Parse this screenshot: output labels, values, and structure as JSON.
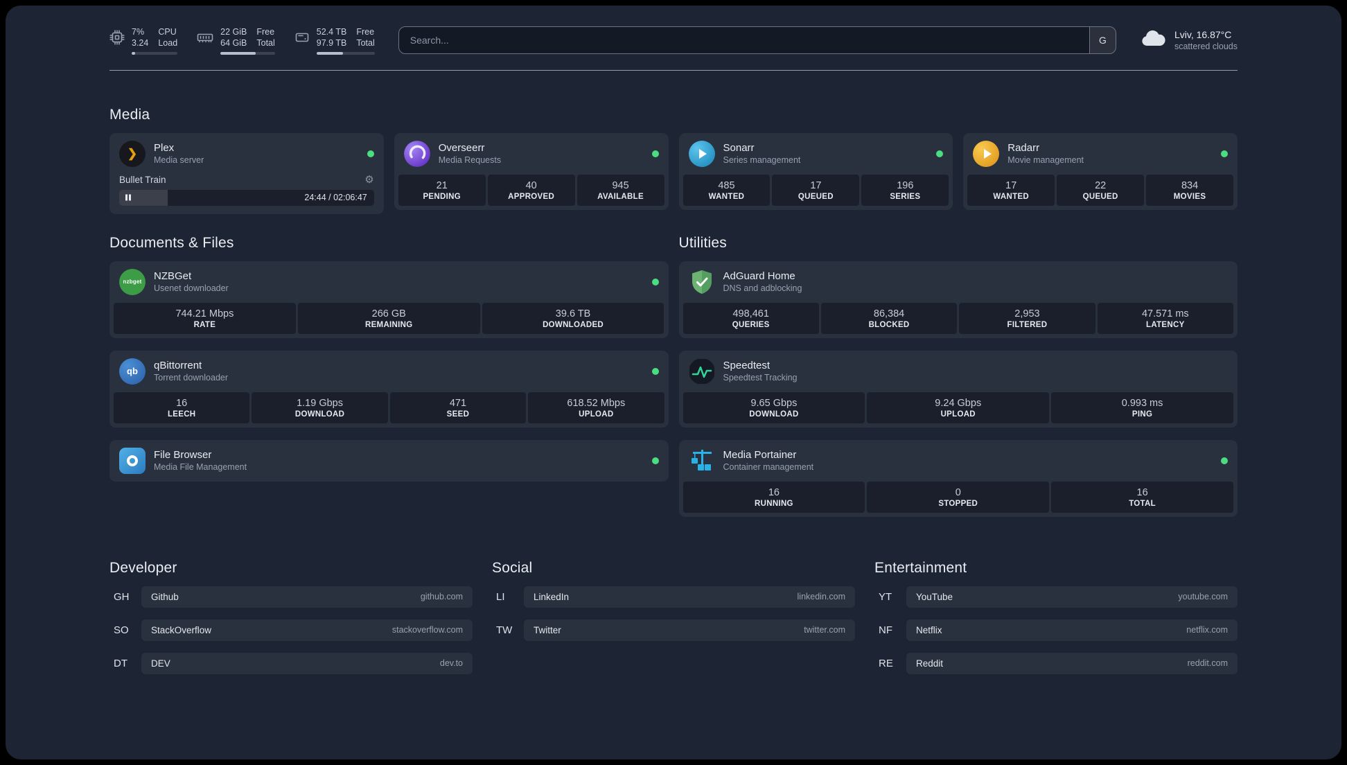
{
  "theme": {
    "background": "#1d2433",
    "status_online": "#4ade80",
    "plex_accent": "#e5a00d",
    "nzbget_green": "#3d9c46",
    "speedtest_green": "#34d399",
    "portainer_blue": "#29b2e8"
  },
  "topbar": {
    "resources": [
      {
        "name": "cpu",
        "values": [
          "7%",
          "3.24"
        ],
        "labels": [
          "CPU",
          "Load"
        ],
        "percent": 7
      },
      {
        "name": "memory",
        "values": [
          "22 GiB",
          "64 GiB"
        ],
        "labels": [
          "Free",
          "Total"
        ],
        "percent": 65
      },
      {
        "name": "disk",
        "values": [
          "52.4 TB",
          "97.9 TB"
        ],
        "labels": [
          "Free",
          "Total"
        ],
        "percent": 46
      }
    ],
    "search": {
      "placeholder": "Search...",
      "engine_label": "G"
    },
    "weather": {
      "location": "Lviv, 16.87°C",
      "condition": "scattered clouds"
    }
  },
  "sections": {
    "media": {
      "title": "Media",
      "services": [
        {
          "name": "Plex",
          "description": "Media server",
          "status": "online",
          "player": {
            "title": "Bullet Train",
            "time": "24:44 / 02:06:47",
            "progress_percent": 19
          }
        },
        {
          "name": "Overseerr",
          "description": "Media Requests",
          "status": "online",
          "stats": [
            {
              "value": "21",
              "label": "PENDING"
            },
            {
              "value": "40",
              "label": "APPROVED"
            },
            {
              "value": "945",
              "label": "AVAILABLE"
            }
          ]
        },
        {
          "name": "Sonarr",
          "description": "Series management",
          "status": "online",
          "stats": [
            {
              "value": "485",
              "label": "WANTED"
            },
            {
              "value": "17",
              "label": "QUEUED"
            },
            {
              "value": "196",
              "label": "SERIES"
            }
          ]
        },
        {
          "name": "Radarr",
          "description": "Movie management",
          "status": "online",
          "stats": [
            {
              "value": "17",
              "label": "WANTED"
            },
            {
              "value": "22",
              "label": "QUEUED"
            },
            {
              "value": "834",
              "label": "MOVIES"
            }
          ]
        }
      ]
    },
    "documents": {
      "title": "Documents & Files",
      "services": [
        {
          "name": "NZBGet",
          "description": "Usenet downloader",
          "status": "online",
          "stats": [
            {
              "value": "744.21 Mbps",
              "label": "RATE"
            },
            {
              "value": "266 GB",
              "label": "REMAINING"
            },
            {
              "value": "39.6 TB",
              "label": "DOWNLOADED"
            }
          ]
        },
        {
          "name": "qBittorrent",
          "description": "Torrent downloader",
          "status": "online",
          "stats": [
            {
              "value": "16",
              "label": "LEECH"
            },
            {
              "value": "1.19 Gbps",
              "label": "DOWNLOAD"
            },
            {
              "value": "471",
              "label": "SEED"
            },
            {
              "value": "618.52 Mbps",
              "label": "UPLOAD"
            }
          ]
        },
        {
          "name": "File Browser",
          "description": "Media File Management",
          "status": "online"
        }
      ]
    },
    "utilities": {
      "title": "Utilities",
      "services": [
        {
          "name": "AdGuard Home",
          "description": "DNS and adblocking",
          "stats": [
            {
              "value": "498,461",
              "label": "QUERIES"
            },
            {
              "value": "86,384",
              "label": "BLOCKED"
            },
            {
              "value": "2,953",
              "label": "FILTERED"
            },
            {
              "value": "47.571 ms",
              "label": "LATENCY"
            }
          ]
        },
        {
          "name": "Speedtest",
          "description": "Speedtest Tracking",
          "stats": [
            {
              "value": "9.65 Gbps",
              "label": "DOWNLOAD"
            },
            {
              "value": "9.24 Gbps",
              "label": "UPLOAD"
            },
            {
              "value": "0.993 ms",
              "label": "PING"
            }
          ]
        },
        {
          "name": "Media Portainer",
          "description": "Container management",
          "status": "online",
          "stats": [
            {
              "value": "16",
              "label": "RUNNING"
            },
            {
              "value": "0",
              "label": "STOPPED"
            },
            {
              "value": "16",
              "label": "TOTAL"
            }
          ]
        }
      ]
    }
  },
  "bookmarks": [
    {
      "title": "Developer",
      "items": [
        {
          "abbr": "GH",
          "name": "Github",
          "url": "github.com"
        },
        {
          "abbr": "SO",
          "name": "StackOverflow",
          "url": "stackoverflow.com"
        },
        {
          "abbr": "DT",
          "name": "DEV",
          "url": "dev.to"
        }
      ]
    },
    {
      "title": "Social",
      "items": [
        {
          "abbr": "LI",
          "name": "LinkedIn",
          "url": "linkedin.com"
        },
        {
          "abbr": "TW",
          "name": "Twitter",
          "url": "twitter.com"
        }
      ]
    },
    {
      "title": "Entertainment",
      "items": [
        {
          "abbr": "YT",
          "name": "YouTube",
          "url": "youtube.com"
        },
        {
          "abbr": "NF",
          "name": "Netflix",
          "url": "netflix.com"
        },
        {
          "abbr": "RE",
          "name": "Reddit",
          "url": "reddit.com"
        }
      ]
    }
  ]
}
